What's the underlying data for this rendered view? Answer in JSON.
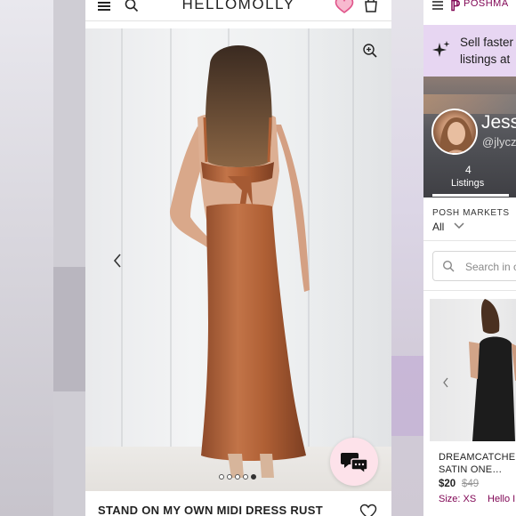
{
  "hellomolly": {
    "logo": "HELLOMOLLY",
    "product_title": "STAND ON MY OWN MIDI DRESS RUST",
    "carousel": {
      "total": 5,
      "active": 4
    },
    "colors": {
      "dress": "#b4653c",
      "chat_bg": "#fde2ea",
      "heart": "#e0548a"
    },
    "icons": [
      "menu-icon",
      "search-icon",
      "heart-icon",
      "bag-icon",
      "zoom-icon",
      "chevron-left-icon",
      "chat-icon",
      "wishlist-heart-icon"
    ]
  },
  "poshmark": {
    "logo": "POSHMA",
    "banner_text": "Sell faster listings at",
    "user": {
      "name": "Jess",
      "handle": "@jlycz"
    },
    "stats": {
      "count": "4",
      "label": "Listings"
    },
    "markets": {
      "label": "POSH MARKETS",
      "value": "All"
    },
    "search_placeholder": "Search in c",
    "product": {
      "title": "DREAMCATCHER SATIN ONE…",
      "price": "$20",
      "original_price": "$49",
      "size": "Size: XS",
      "brand": "Hello I"
    },
    "colors": {
      "brand": "#7f0353",
      "banner": "#e7d6f2"
    }
  }
}
